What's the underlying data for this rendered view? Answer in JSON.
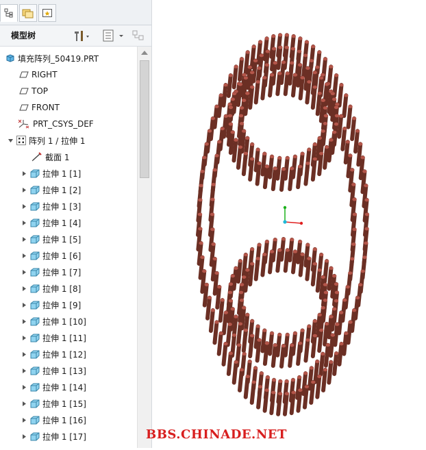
{
  "panel": {
    "title": "模型树",
    "tabs": [
      {
        "icon": "model-tree-icon",
        "active": true
      },
      {
        "icon": "folder-browser-icon",
        "active": false
      },
      {
        "icon": "favorites-icon",
        "active": false
      }
    ],
    "toolbar_icons": [
      "settings-icon",
      "tree-filter-icon",
      "show-icon"
    ]
  },
  "tree": {
    "root": "填充阵列_50419.PRT",
    "datums": [
      {
        "label": "RIGHT",
        "icon": "datum-plane-icon"
      },
      {
        "label": "TOP",
        "icon": "datum-plane-icon"
      },
      {
        "label": "FRONT",
        "icon": "datum-plane-icon"
      },
      {
        "label": "PRT_CSYS_DEF",
        "icon": "csys-icon"
      }
    ],
    "pattern": "阵列 1 / 拉伸 1",
    "section": "截面 1",
    "members": [
      "拉伸 1 [1]",
      "拉伸 1 [2]",
      "拉伸 1 [3]",
      "拉伸 1 [4]",
      "拉伸 1 [5]",
      "拉伸 1 [6]",
      "拉伸 1 [7]",
      "拉伸 1 [8]",
      "拉伸 1 [9]",
      "拉伸 1 [10]",
      "拉伸 1 [11]",
      "拉伸 1 [12]",
      "拉伸 1 [13]",
      "拉伸 1 [14]",
      "拉伸 1 [15]",
      "拉伸 1 [16]",
      "拉伸 1 [17]"
    ]
  },
  "viewport": {
    "rod_color": "#6b2f24",
    "rod_top_color": "#b4564a",
    "axis_colors": {
      "x": "#e02020",
      "y": "#1ab01a",
      "z": "#1fb8d8"
    }
  },
  "watermark": "BBS.CHINADE.NET"
}
